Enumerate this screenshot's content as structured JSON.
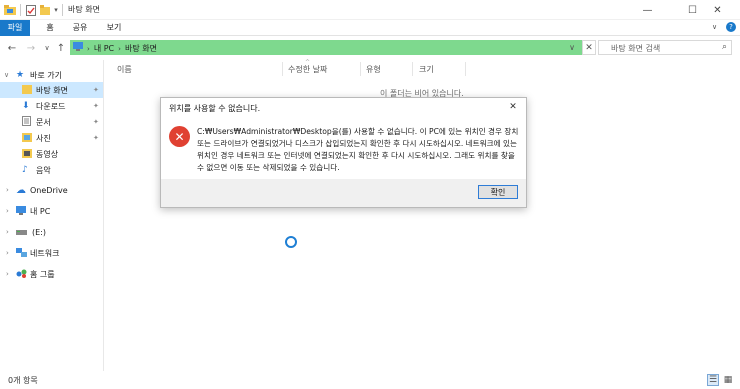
{
  "window": {
    "title": "바탕 화면",
    "minimize_glyph": "—",
    "maximize_glyph": "☐",
    "close_glyph": "✕"
  },
  "ribbon": {
    "tabs": [
      "파일",
      "홈",
      "공유",
      "보기"
    ]
  },
  "address": {
    "crumbs": [
      "내 PC",
      "바탕 화면"
    ],
    "search_placeholder": "바탕 화면 검색"
  },
  "nav": {
    "quick_access": "바로 가기",
    "items": [
      {
        "label": "바탕 화면",
        "icon": "desktop-folder-icon",
        "pinned": true
      },
      {
        "label": "다운로드",
        "icon": "download-folder-icon",
        "pinned": true
      },
      {
        "label": "문서",
        "icon": "documents-folder-icon",
        "pinned": true
      },
      {
        "label": "사진",
        "icon": "pictures-folder-icon",
        "pinned": true
      },
      {
        "label": "동영상",
        "icon": "videos-folder-icon",
        "pinned": false
      },
      {
        "label": "음악",
        "icon": "music-folder-icon",
        "pinned": false
      }
    ],
    "onedrive": "OneDrive",
    "this_pc": "내 PC",
    "drive": "(E:)",
    "network": "네트워크",
    "homegroup": "홈 그룹"
  },
  "columns": [
    "이름",
    "수정한 날짜",
    "유형",
    "크기"
  ],
  "empty_message": "이 폴더는 비어 있습니다.",
  "status": {
    "item_count": "0개 항목"
  },
  "dialog": {
    "title": "위치를 사용할 수 없습니다.",
    "message": "C:₩Users₩Administrator₩Desktop을(를) 사용할 수 없습니다. 이 PC에 있는 위치인 경우 장치 또는 드라이브가 연결되었거나 디스크가 삽입되었는지 확인한 후 다시 시도하십시오. 네트워크에 있는 위치인 경우 네트워크 또는 인터넷에 연결되었는지 확인한 후 다시 시도하십시오. 그래도 위치를 찾을 수 없으면 이동 또는 삭제되었을 수 있습니다.",
    "ok_label": "확인"
  },
  "colors": {
    "accent": "#1979ca",
    "address_bar": "#7ed98e",
    "selection": "#cce8ff",
    "error": "#e04132"
  }
}
